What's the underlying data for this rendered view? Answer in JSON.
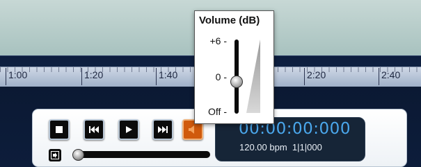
{
  "ruler": {
    "labels": [
      "1:00",
      "1:20",
      "1:40",
      "2:20",
      "2:40"
    ]
  },
  "transport": {
    "buttons": [
      {
        "name": "stop-button",
        "icon": "stop-icon"
      },
      {
        "name": "rewind-button",
        "icon": "skip-back-icon"
      },
      {
        "name": "play-button",
        "icon": "play-icon"
      },
      {
        "name": "fast-forward-button",
        "icon": "skip-forward-icon"
      },
      {
        "name": "volume-button",
        "icon": "speaker-icon"
      }
    ],
    "snap_icon": "snap-icon",
    "position_slider_value": 0
  },
  "display": {
    "time": "00:00:00:000",
    "tempo": "120.00 bpm",
    "position": "1|1|000"
  },
  "volume_popup": {
    "title": "Volume (dB)",
    "label_max": "+6 -",
    "label_mid": "0 -",
    "label_min": "Off -"
  },
  "colors": {
    "accent_orange": "#d05a0c",
    "display_time": "#4aa7ec",
    "panel_dark": "#0c1a36"
  }
}
